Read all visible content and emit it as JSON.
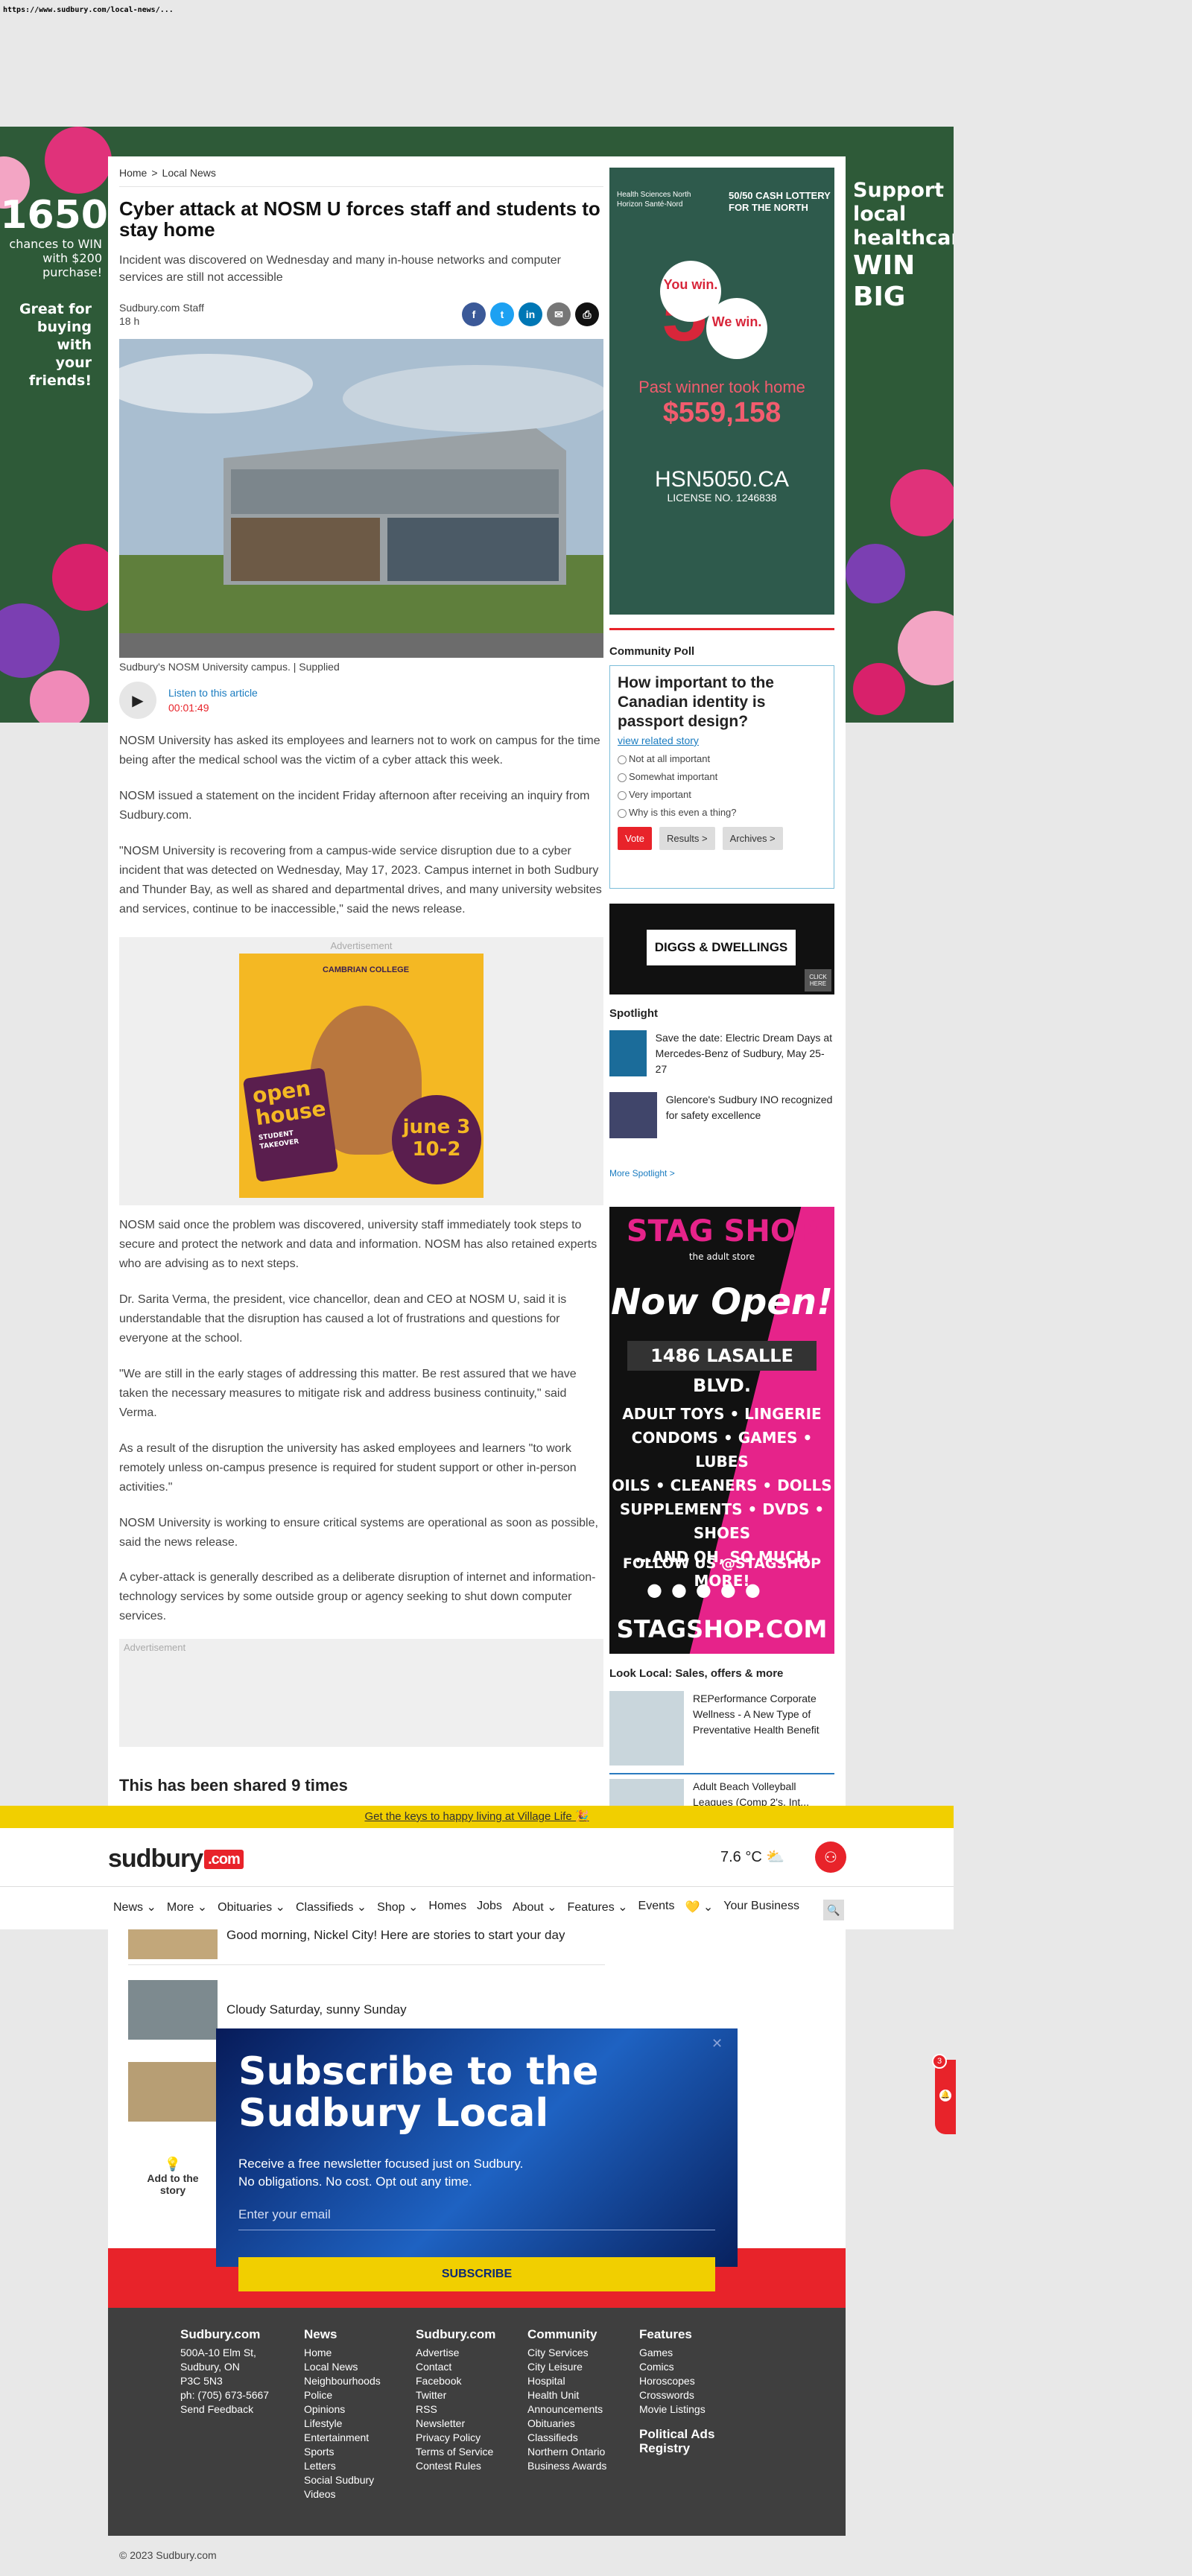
{
  "url": "https://www.sudbury.com/local-news/...",
  "left_ad": {
    "amount": "1650",
    "line1": "chances to WIN",
    "line2": "with $200 purchase!",
    "tag1": "Great for",
    "tag2": "buying with",
    "tag3": "your friends!"
  },
  "right_ad": {
    "line1": "Support",
    "line2": "local",
    "line3": "healthcare",
    "line4": "WIN BIG"
  },
  "breadcrumb": {
    "home": "Home",
    "sep": ">",
    "section": "Local News"
  },
  "article": {
    "title": "Cyber attack at NOSM U forces staff and students to stay home",
    "dek": "Incident was discovered on Wednesday and many in-house networks and computer services are still not accessible",
    "author": "Sudbury.com Staff",
    "time": "18 h",
    "caption": "Sudbury's NOSM University campus. | Supplied",
    "listen_label": "Listen to this article",
    "listen_duration": "00:01:49",
    "paragraphs": [
      "NOSM University has asked its employees and learners not to work on campus for the time being after the medical school was the victim of a cyber attack this week.",
      "NOSM issued a statement on the incident Friday afternoon after receiving an inquiry from Sudbury.com.",
      "\"NOSM University is recovering from a campus-wide service disruption due to a cyber incident that was detected on Wednesday, May 17, 2023. Campus internet in both Sudbury and Thunder Bay, as well as shared and departmental drives, and many university websites and services, continue to be inaccessible,\" said the news release.",
      "NOSM said once the problem was discovered, university staff immediately took steps to secure and protect the network and data and information. NOSM has also retained experts who are advising as to next steps.",
      "Dr. Sarita Verma, the president, vice chancellor, dean and CEO at NOSM U, said it is understandable that the disruption has caused a lot of frustrations and questions for everyone at the school.",
      "\"We are still in the early stages of addressing this matter. Be rest assured that we have taken the necessary measures to mitigate risk and address business continuity,\" said Verma.",
      "As a result of the disruption the university has asked employees and learners \"to work remotely unless on-campus presence is required for student support or other in-person activities.\"",
      "NOSM University is working to ensure critical systems are operational as soon as possible, said the news release.",
      "A cyber-attack is generally described as a deliberate disruption of internet and information-technology services by some outside group or agency seeking to shut down computer services."
    ],
    "shared": "This has been shared 9 times"
  },
  "ad_label": "Advertisement",
  "cambrian_ad": {
    "brand": "CAMBRIAN COLLEGE",
    "badge1": "open",
    "badge2": "house",
    "badge3": "STUDENT TAKEOVER",
    "date1": "june 3",
    "date2": "10-2"
  },
  "lottery_ad": {
    "org": "Health Sciences North Horizon Santé-Nord",
    "head1": "50/50 CASH LOTTERY",
    "head2": "FOR THE NORTH",
    "big": "50/50",
    "you": "You win.",
    "we": "We win.",
    "past": "Past winner took home",
    "amount": "$559,158",
    "site": "HSN5050.CA",
    "license": "LICENSE NO. 1246838"
  },
  "poll": {
    "heading": "Community Poll",
    "question": "How important to the Canadian identity is passport design?",
    "related": "view related story",
    "options": [
      "Not at all important",
      "Somewhat important",
      "Very important",
      "Why is this even a thing?"
    ],
    "vote": "Vote",
    "results": "Results >",
    "archives": "Archives >"
  },
  "diggs_ad": {
    "text": "DIGGS & DWELLINGS",
    "click": "CLICK HERE"
  },
  "spotlight": {
    "heading": "Spotlight",
    "items": [
      "Save the date: Electric Dream Days at Mercedes-Benz of Sudbury, May 25-27",
      "Glencore's Sudbury INO recognized for safety excellence"
    ],
    "more": "More Spotlight >"
  },
  "stag_ad": {
    "brand": "STAG SHOP",
    "sub": "the adult store",
    "open": "Now Open!",
    "addr": "1486 LASALLE BLVD.",
    "l1": "ADULT TOYS • LINGERIE",
    "l2": "CONDOMS • GAMES • LUBES",
    "l3": "OILS • CLEANERS • DOLLS",
    "l4": "SUPPLEMENTS • DVDS • SHOES",
    "l5": "...AND OH, SO MUCH MORE!",
    "follow": "FOLLOW US @STAGSHOP",
    "site": "STAGSHOP.COM"
  },
  "look_local": {
    "heading": "Look Local: Sales, offers & more",
    "items": [
      "REPerformance Corporate Wellness - A New Type of Preventative Health Benefit",
      "Adult Beach Volleyball Leagues (Comp 2's, Int..."
    ]
  },
  "promo_banner": "Get the keys to happy living at Village Life 🎉",
  "header": {
    "logo": "sudbury",
    "logo_suffix": ".com",
    "temp": "7.6 °C"
  },
  "nav": [
    "News ⌄",
    "More ⌄",
    "Obituaries ⌄",
    "Classifieds ⌄",
    "Shop ⌄",
    "Homes",
    "Jobs",
    "About ⌄",
    "Features ⌄",
    "Events",
    "💛 ⌄",
    "Your Business"
  ],
  "stories": [
    "Good morning, Nickel City! Here are stories to start your day",
    "Cloudy Saturday, sunny Sunday"
  ],
  "add_story": {
    "l1": "Add to the",
    "l2": "story"
  },
  "notif_count": "3",
  "modal": {
    "title": "Subscribe to the Sudbury Local",
    "sub1": "Receive a free newsletter focused just on Sudbury.",
    "sub2": "No obligations. No cost. Opt out any time.",
    "placeholder": "Enter your email",
    "button": "SUBSCRIBE"
  },
  "footer": {
    "col1": {
      "title": "Sudbury.com",
      "items": [
        "500A-10 Elm St,",
        "Sudbury, ON",
        "P3C 5N3",
        "ph: (705) 673-5667",
        "Send Feedback"
      ]
    },
    "col2": {
      "title": "News",
      "items": [
        "Home",
        "Local News",
        "Neighbourhoods",
        "Police",
        "Opinions",
        "Lifestyle",
        "Entertainment",
        "Sports",
        "Letters",
        "Social Sudbury",
        "Videos"
      ]
    },
    "col3": {
      "title": "Sudbury.com",
      "items": [
        "Advertise",
        "Contact",
        "Facebook",
        "Twitter",
        "RSS",
        "Newsletter",
        "Privacy Policy",
        "Terms of Service",
        "Contest Rules"
      ]
    },
    "col4": {
      "title": "Community",
      "items": [
        "City Services",
        "City Leisure",
        "Hospital",
        "Health Unit",
        "Announcements",
        "Obituaries",
        "Classifieds",
        "Northern Ontario",
        "Business Awards"
      ]
    },
    "col5": {
      "title": "Features",
      "items": [
        "Games",
        "Comics",
        "Horoscopes",
        "Crosswords",
        "Movie Listings"
      ],
      "extra1": "Political Ads",
      "extra2": "Registry"
    },
    "copyright": "© 2023 Sudbury.com"
  }
}
